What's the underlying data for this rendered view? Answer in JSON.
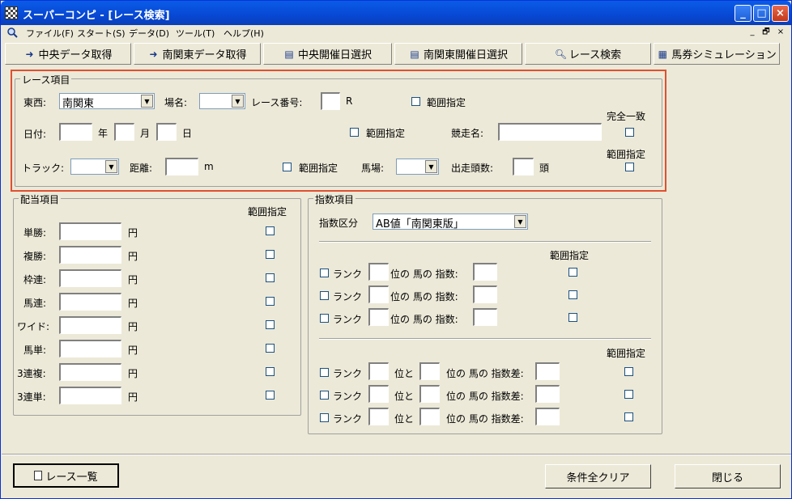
{
  "window": {
    "title": "スーパーコンピ - [レース検索]",
    "minimize": "_",
    "maximize": "□",
    "close": "×"
  },
  "menu": {
    "items": [
      "ファイル(F)",
      "スタート(S)",
      "データ(D)",
      "ツール(T)",
      "ヘルプ(H)"
    ],
    "mdi_min": "_",
    "mdi_restore": "🗗",
    "mdi_close": "×"
  },
  "toolbar": {
    "central_fetch": "中央データ取得",
    "minami_fetch": "南関東データ取得",
    "central_date": "中央開催日選択",
    "minami_date": "南関東開催日選択",
    "race_search": "レース検索",
    "ticket_sim": "馬券シミュレーション"
  },
  "race": {
    "group_title": "レース項目",
    "east_west_label": "東西:",
    "east_west_value": "南関東",
    "venue_label": "場名:",
    "venue_value": "",
    "race_no_label": "レース番号:",
    "race_no_unit": "R",
    "range_label": "範囲指定",
    "date_label": "日付:",
    "year_unit": "年",
    "month_unit": "月",
    "day_unit": "日",
    "race_name_label": "競走名:",
    "exact_match_label": "完全一致",
    "track_label": "トラック:",
    "distance_label": "距離:",
    "distance_unit": "m",
    "going_label": "馬場:",
    "runners_label": "出走頭数:",
    "runners_unit": "頭"
  },
  "payout": {
    "group_title": "配当項目",
    "range_label": "範囲指定",
    "yen": "円",
    "rows": [
      "単勝:",
      "複勝:",
      "枠連:",
      "馬連:",
      "ワイド:",
      "馬単:",
      "3連複:",
      "3連単:"
    ]
  },
  "index": {
    "group_title": "指数項目",
    "type_label": "指数区分",
    "type_value": "AB値「南関東版」",
    "range_label": "範囲指定",
    "rank_label": "ランク",
    "pos_index_label": "位の 馬の 指数:",
    "pos_and_label": "位と",
    "pos_diff_label": "位の 馬の 指数差:"
  },
  "footer": {
    "race_list": "レース一覧",
    "clear_all": "条件全クリア",
    "close": "閉じる"
  }
}
